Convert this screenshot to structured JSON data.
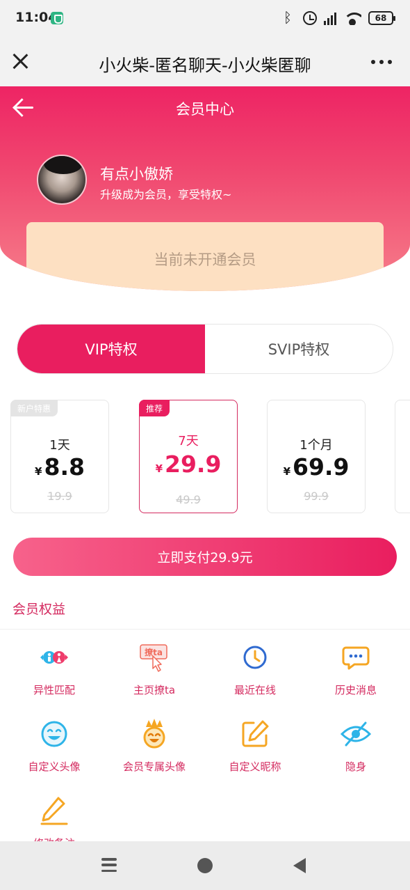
{
  "status": {
    "time": "11:04",
    "battery": "68"
  },
  "titlebar": {
    "title": "小火柴-匿名聊天-小火柴匿聊"
  },
  "header": {
    "title": "会员中心",
    "username": "有点小傲娇",
    "subtitle": "升级成为会员，享受特权~",
    "vip_status": "当前未开通会员"
  },
  "tabs": [
    {
      "label": "VIP特权",
      "active": true
    },
    {
      "label": "SVIP特权",
      "active": false
    }
  ],
  "plans": [
    {
      "badge": "新户特惠",
      "duration": "1天",
      "currency": "¥",
      "price": "8.8",
      "original": "19.9",
      "selected": false
    },
    {
      "badge": "推荐",
      "duration": "7天",
      "currency": "¥",
      "price": "29.9",
      "original": "49.9",
      "selected": true
    },
    {
      "badge": "",
      "duration": "1个月",
      "currency": "¥",
      "price": "69.9",
      "original": "99.9",
      "selected": false
    }
  ],
  "pay_button": "立即支付29.9元",
  "benefits_title": "会员权益",
  "benefits": [
    {
      "label": "异性匹配",
      "icon": "gender-match-icon"
    },
    {
      "label": "主页撩ta",
      "icon": "flirt-icon"
    },
    {
      "label": "最近在线",
      "icon": "clock-icon"
    },
    {
      "label": "历史消息",
      "icon": "chat-history-icon"
    },
    {
      "label": "自定义头像",
      "icon": "smiley-icon"
    },
    {
      "label": "会员专属头像",
      "icon": "crown-face-icon"
    },
    {
      "label": "自定义昵称",
      "icon": "edit-square-icon"
    },
    {
      "label": "隐身",
      "icon": "eye-off-icon"
    },
    {
      "label": "修改备注",
      "icon": "pencil-icon"
    }
  ],
  "colors": {
    "accent": "#e91e5f",
    "card": "#fde0c2"
  }
}
